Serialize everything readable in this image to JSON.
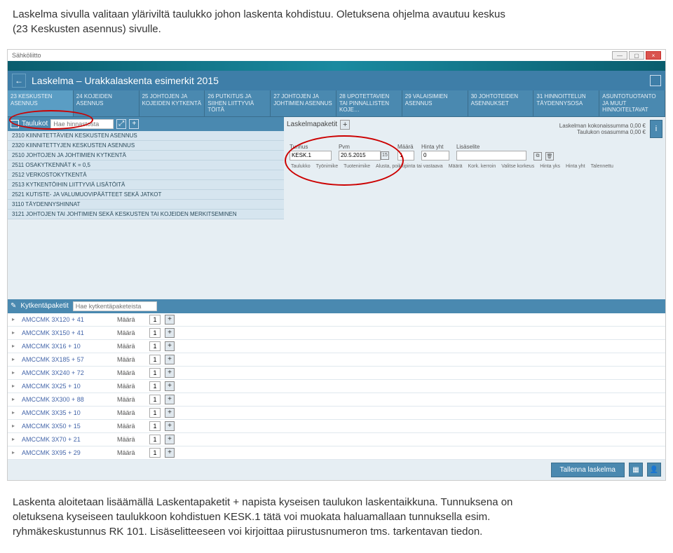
{
  "intro": {
    "line1": "Laskelma sivulla valitaan yläriviltä taulukko johon laskenta kohdistuu. Oletuksena ohjelma avautuu keskus",
    "line2": "(23 Keskusten asennus) sivulle."
  },
  "topbar": {
    "org": "Sähköliitto"
  },
  "titlebar": {
    "title": "Laskelma – Urakkalaskenta esimerkit 2015"
  },
  "tabs": [
    "23 KESKUSTEN ASENNUS",
    "24 KOJEIDEN ASENNUS",
    "25 JOHTOJEN JA KOJEIDEN KYTKENTÄ",
    "26 PUTKITUS JA SIIHEN LIITTYVIÄ TÖITÄ",
    "27 JOHTOJEN JA JOHTIMIEN ASENNUS",
    "28 UPOTETTAVIEN TAI PINNALLISTEN KOJE…",
    "29 VALAISIMIEN ASENNUS",
    "30 JOHTOTEIDEN ASENNUKSET",
    "31 HINNOITTELUN TÄYDENNYSOSA",
    "ASUNTOTUOTANTO JA MUUT HINNOITELTAVAT"
  ],
  "left": {
    "panel_title": "Taulukot",
    "search_ph": "Hae hinnastosta",
    "expand_icon": "⤢",
    "plus": "+",
    "rows": [
      "2310  KIINNITETTÄVIEN KESKUSTEN ASENNUS",
      "2320  KIINNITETTYJEN KESKUSTEN ASENNUS",
      "2510  JOHTOJEN JA JOHTIMIEN KYTKENTÄ",
      "2511  OSAKYTKENNÄT   k = 0,5",
      "2512  VERKOSTOKYTKENTÄ",
      "2513  KYTKENTÖIHIN LIITTYVIÄ LISÄTÖITÄ",
      "2521  KUTISTE- JA VALUMUOVIPÄÄTTEET SEKÄ JATKOT",
      "3110  TÄYDENNYSHINNAT",
      "3121  JOHTOJEN TAI JOHTIMIEN SEKÄ KESKUSTEN TAI KOJEIDEN MERKITSEMINEN"
    ]
  },
  "right": {
    "label": "Laskelmapaketit",
    "plus": "+",
    "sum1": "Laskelman kokonaissumma  0,00 €",
    "sum2": "Taulukon osasumma  0,00 €",
    "form": {
      "tunnus_lbl": "Tunnus",
      "tunnus_val": "KESK.1",
      "pvm_lbl": "Pvm",
      "pvm_val": "20.5.2015",
      "maara_lbl": "Määrä",
      "maara_val": "1",
      "hinta_lbl": "Hinta yht",
      "hinta_val": "0",
      "lisa_lbl": "Lisäselite"
    },
    "cols": [
      "Taulukko",
      "Työnimike",
      "Tuotenimike",
      "Alusta, poikkipinta tai vastaava",
      "Määrä",
      "Kork. kerroin",
      "Valitse korkeus",
      "Hinta yks",
      "Hinta yht",
      "Talennettu"
    ]
  },
  "kp": {
    "title": "Kytkentäpaketit",
    "search_ph": "Hae kytkentäpaketeista",
    "maara_lbl": "Määrä",
    "rows": [
      {
        "name": "AMCCMK 3X120 + 41",
        "qty": "1"
      },
      {
        "name": "AMCCMK 3X150 + 41",
        "qty": "1"
      },
      {
        "name": "AMCCMK 3X16 + 10",
        "qty": "1"
      },
      {
        "name": "AMCCMK 3X185 + 57",
        "qty": "1"
      },
      {
        "name": "AMCCMK 3X240 + 72",
        "qty": "1"
      },
      {
        "name": "AMCCMK 3X25 + 10",
        "qty": "1"
      },
      {
        "name": "AMCCMK 3X300 + 88",
        "qty": "1"
      },
      {
        "name": "AMCCMK 3X35 + 10",
        "qty": "1"
      },
      {
        "name": "AMCCMK 3X50 + 15",
        "qty": "1"
      },
      {
        "name": "AMCCMK 3X70 + 21",
        "qty": "1"
      },
      {
        "name": "AMCCMK 3X95 + 29",
        "qty": "1"
      }
    ]
  },
  "footer": {
    "save": "Tallenna laskelma"
  },
  "outro": {
    "line1": "Laskenta aloitetaan lisäämällä Laskentapaketit + napista kyseisen taulukon laskentaikkuna. Tunnuksena on",
    "line2": "oletuksena kyseiseen taulukkoon kohdistuen KESK.1 tätä voi muokata haluamallaan tunnuksella esim.",
    "line3": "ryhmäkeskustunnus RK 101. Lisäselitteeseen voi kirjoittaa piirustusnumeron tms. tarkentavan tiedon."
  }
}
